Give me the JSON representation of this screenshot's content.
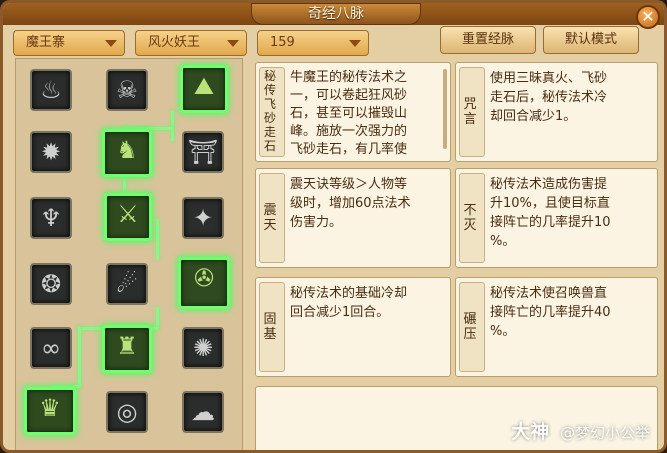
{
  "window": {
    "title": "奇经八脉"
  },
  "toolbar": {
    "dropdown_faction": "魔王寨",
    "dropdown_school": "风火妖王",
    "dropdown_level": "159",
    "reset_button": "重置经脉",
    "default_button": "默认模式",
    "close_glyph": "✕"
  },
  "skills": [
    {
      "icon": "flame-claw-icon",
      "glyph": "♨",
      "active": false
    },
    {
      "icon": "demon-head-icon",
      "glyph": "☠",
      "active": false
    },
    {
      "icon": "wind-mountain-icon",
      "glyph": "⛰",
      "active": true
    },
    {
      "icon": "fire-burst-icon",
      "glyph": "✹",
      "active": false
    },
    {
      "icon": "demon-beast-icon",
      "glyph": "♞",
      "active": true
    },
    {
      "icon": "rock-pillar-icon",
      "glyph": "⛩",
      "active": false
    },
    {
      "icon": "brazier-icon",
      "glyph": "♆",
      "active": false
    },
    {
      "icon": "sword-scroll-icon",
      "glyph": "⚔",
      "active": true
    },
    {
      "icon": "skull-wind-icon",
      "glyph": "✦",
      "active": false
    },
    {
      "icon": "sun-seal-icon",
      "glyph": "❂",
      "active": false
    },
    {
      "icon": "rubble-icon",
      "glyph": "☄",
      "active": false
    },
    {
      "icon": "compass-ring-icon",
      "glyph": "✇",
      "active": true
    },
    {
      "icon": "bubble-chain-icon",
      "glyph": "∞",
      "active": false
    },
    {
      "icon": "armored-warrior-icon",
      "glyph": "♜",
      "active": true
    },
    {
      "icon": "dark-flower-icon",
      "glyph": "✺",
      "active": false
    },
    {
      "icon": "dragon-icon",
      "glyph": "♛",
      "active": true
    },
    {
      "icon": "whirlwind-icon",
      "glyph": "◎",
      "active": false
    },
    {
      "icon": "storm-cloud-icon",
      "glyph": "☁",
      "active": false
    }
  ],
  "cards": [
    {
      "label": "秘传飞砂走石",
      "desc": "牛魔王的秘传法术之\n一，可以卷起狂风砂\n石，甚至可以摧毁山\n峰。施放一次强力的\n飞砂走石，有几率使"
    },
    {
      "label": "咒言",
      "desc": "使用三昧真火、飞砂\n走石后，秘传法术冷\n却回合减少1。"
    },
    {
      "label": "震天",
      "desc": "震天诀等级＞人物等\n级时，增加60点法术\n伤害力。"
    },
    {
      "label": "不灭",
      "desc": "秘传法术造成伤害提\n升10%，且使目标直\n接阵亡的几率提升10\n%。"
    },
    {
      "label": "固基",
      "desc": "秘传法术的基础冷却\n回合减少1回合。"
    },
    {
      "label": "碾压",
      "desc": "秘传法术使召唤兽直\n接阵亡的几率提升40\n%。"
    }
  ],
  "watermark": {
    "brand": "大神",
    "user": "@梦幻小公举"
  }
}
